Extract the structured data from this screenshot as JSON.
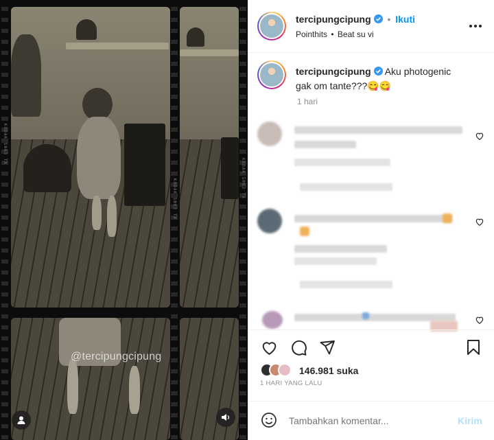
{
  "post": {
    "username": "tercipungcipung",
    "follow_label": "Ikuti",
    "dot": "•",
    "audio_artist": "Pointhits",
    "audio_sep": "•",
    "audio_track": "Beat su vi",
    "more": "•••"
  },
  "caption": {
    "username": "tercipungcipung",
    "text": "Aku photogenic gak om tante???😋😋",
    "time": "1 hari"
  },
  "media": {
    "watermark": "@tercipungcipung",
    "film_text": "KODAK 5063 TX"
  },
  "engagement": {
    "likes_count": "146.981",
    "likes_label": "suka",
    "timestamp": "1 HARI YANG LALU"
  },
  "composer": {
    "placeholder": "Tambahkan komentar...",
    "submit": "Kirim"
  },
  "colors": {
    "accent": "#0095f6",
    "submit_disabled": "#b2dffc",
    "text": "#262626",
    "muted": "#8e8e8e"
  },
  "icons": [
    "verified-badge-icon",
    "more-options-icon",
    "heart-icon",
    "comment-icon",
    "share-icon",
    "bookmark-icon",
    "emoji-icon",
    "user-tag-icon",
    "sound-icon"
  ]
}
